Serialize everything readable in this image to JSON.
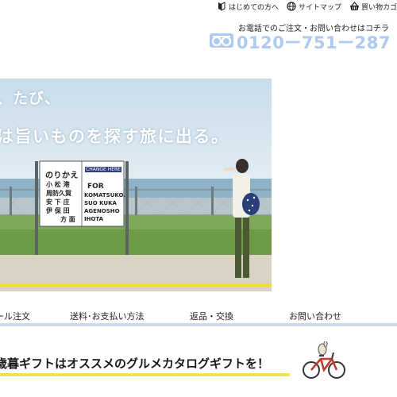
{
  "header": {
    "links": [
      {
        "label": "はじめての方へ",
        "icon": "beginner-icon"
      },
      {
        "label": "サイトマップ",
        "icon": "globe-icon"
      },
      {
        "label": "買い物カゴ",
        "icon": "basket-icon"
      }
    ],
    "phone_label": "お電話でのご注文・お問い合わせはコチラ",
    "phone_number": "0120ー751ー287",
    "phone_icon": "freedial-icon"
  },
  "hero": {
    "line1": "、たび、",
    "line2": "は旨いものを探す旅に出る。",
    "sign": {
      "title": "のりかえ",
      "change_here": "CHANGE HERE",
      "for": "FOR",
      "stations_ja": [
        "小 松 港",
        "周防久賀",
        "安 下 庄",
        "伊 保 田",
        "方 面"
      ],
      "stations_en": [
        "KOMATSUKO.",
        "SUO KUKA",
        "AGENOSHO",
        "IHOTA"
      ]
    }
  },
  "nav": {
    "items": [
      "ール注文",
      "送料･お支払い方法",
      "返品・交換",
      "お問い合わせ"
    ]
  },
  "promo": {
    "text": "歳暮ギフトはオススメのグルメカタログギフトを！",
    "icon": "bicycle-icon"
  },
  "colors": {
    "accent_phone": "#aecaf0",
    "nav_rule": "#cfd9ee",
    "promo_underline": "#f3e24c"
  }
}
